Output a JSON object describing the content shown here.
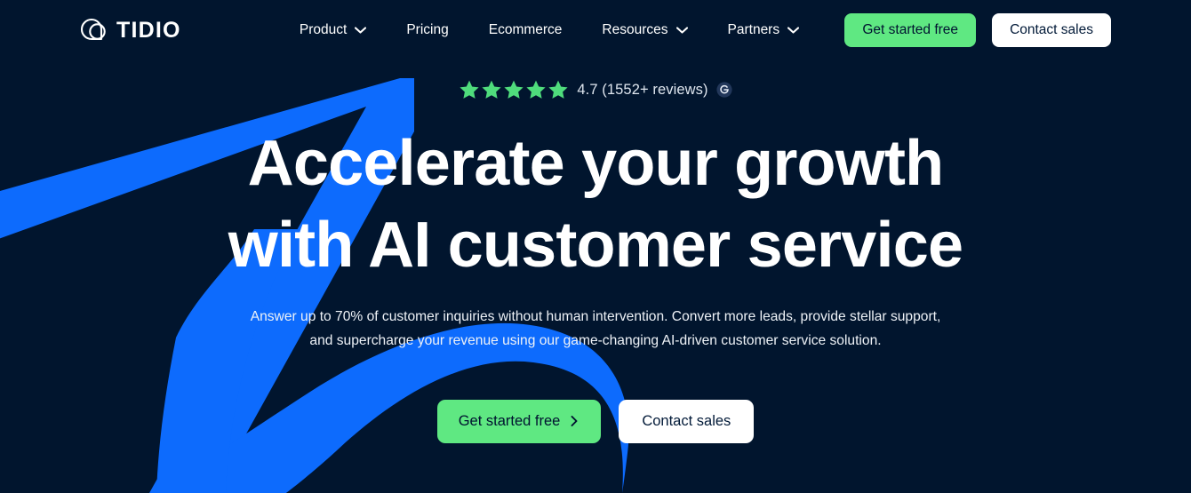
{
  "brand": {
    "name": "TIDIO",
    "logo_icon": "tidio-speech-bubble-logo",
    "colors": {
      "background": "#01152e",
      "accent_blue": "#0d6bfd",
      "accent_green": "#5fe882",
      "star_green": "#4fdc7c",
      "text_white": "#ffffff"
    }
  },
  "header": {
    "nav": [
      {
        "label": "Product",
        "has_dropdown": true,
        "icon": "chevron-down-icon"
      },
      {
        "label": "Pricing",
        "has_dropdown": false,
        "icon": ""
      },
      {
        "label": "Ecommerce",
        "has_dropdown": false,
        "icon": ""
      },
      {
        "label": "Resources",
        "has_dropdown": true,
        "icon": "chevron-down-icon"
      },
      {
        "label": "Partners",
        "has_dropdown": true,
        "icon": "chevron-down-icon"
      }
    ],
    "primary_cta": "Get started free",
    "secondary_cta": "Contact sales"
  },
  "hero": {
    "rating": {
      "stars_filled": 5,
      "stars_total": 5,
      "score": "4.7",
      "text": "4.7 (1552+ reviews)",
      "source_icon": "google-badge-icon"
    },
    "headline_line1": "Accelerate your growth",
    "headline_line2": "with AI customer service",
    "subcopy": "Answer up to 70% of customer inquiries without human intervention. Convert more leads, provide stellar support, and supercharge your revenue using our game-changing AI-driven customer service solution.",
    "primary_cta": "Get started free",
    "primary_cta_icon": "chevron-right-icon",
    "secondary_cta": "Contact sales"
  }
}
